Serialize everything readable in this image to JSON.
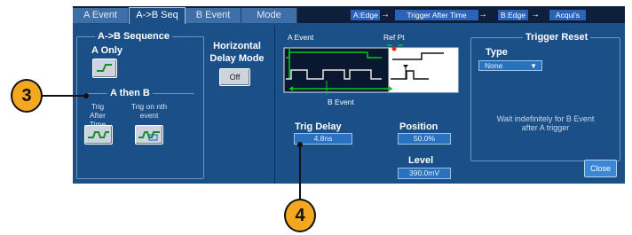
{
  "tabs": [
    {
      "label": "A Event",
      "active": false
    },
    {
      "label": "A->B Seq",
      "active": true
    },
    {
      "label": "B Event",
      "active": false
    },
    {
      "label": "Mode",
      "active": false
    }
  ],
  "sequence": {
    "step1": "A:Edge",
    "step2": "Trigger After Time",
    "step3": "B:Edge",
    "step4": "Acqui's",
    "arrow": "→"
  },
  "ab_sequence": {
    "title": "A->B Sequence",
    "a_only": "A Only",
    "a_then_b": "A then B",
    "trig_after_time": "Trig After Time",
    "trig_on_nth_event": "Trig on nth event"
  },
  "horizontal_delay": {
    "label": "Horizontal Delay Mode",
    "button": "Off"
  },
  "waveform": {
    "a_event_label": "A Event",
    "ref_pt_label": "Ref Pt",
    "b_event_label": "B Event"
  },
  "trig_delay": {
    "label": "Trig Delay",
    "value": "4.8ns"
  },
  "position": {
    "label": "Position",
    "value": "50.0%"
  },
  "level": {
    "label": "Level",
    "value": "390.0mV"
  },
  "trigger_reset": {
    "title": "Trigger Reset",
    "type_label": "Type",
    "type_value": "None",
    "description": "Wait indefinitely for B Event after A trigger"
  },
  "close_label": "Close",
  "callouts": {
    "c3": "3",
    "c4": "4"
  },
  "colors": {
    "panel": "#1b4f88",
    "tabbar": "#0e1f3c",
    "callout": "#f3a81f",
    "trace": "#00c81e"
  }
}
